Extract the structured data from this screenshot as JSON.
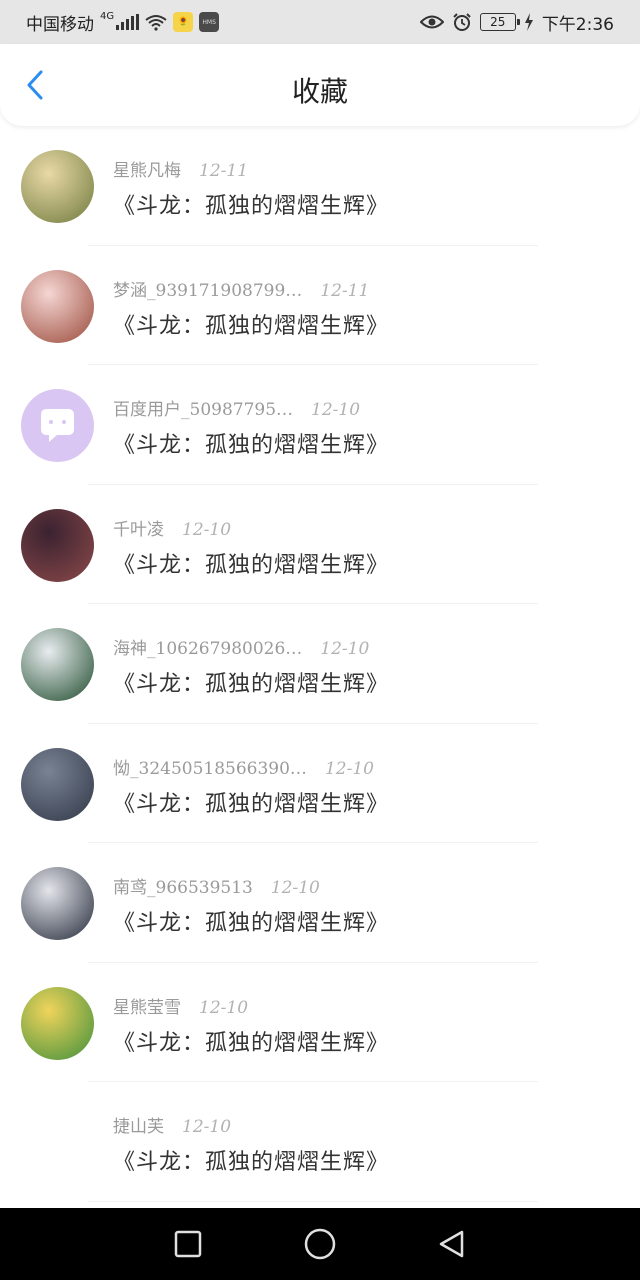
{
  "status_bar": {
    "carrier": "中国移动",
    "network": "4G",
    "app_badge_1": "🌻",
    "app_badge_2": "HMS",
    "battery": "25",
    "time": "下午2:36"
  },
  "header": {
    "title": "收藏",
    "back_icon": "chevron-left-icon"
  },
  "favorites": [
    {
      "user": "星熊凡梅",
      "date": "12-11",
      "title": "《斗龙：孤独的熠熠生辉》",
      "avatar_colors": [
        "#e9d9a8",
        "#6f7a3c"
      ]
    },
    {
      "user": "梦涵_939171908799…",
      "date": "12-11",
      "title": "《斗龙：孤独的熠熠生辉》",
      "avatar_colors": [
        "#f5d6d3",
        "#9a4a3a"
      ]
    },
    {
      "user": "百度用户_50987795…",
      "date": "12-10",
      "title": "《斗龙：孤独的熠熠生辉》",
      "avatar_colors": [
        "#d9c6f3",
        "#d9c6f3"
      ]
    },
    {
      "user": "千叶凌",
      "date": "12-10",
      "title": "《斗龙：孤独的熠熠生辉》",
      "avatar_colors": [
        "#3a2230",
        "#8c4a4a"
      ]
    },
    {
      "user": "海神_106267980026…",
      "date": "12-10",
      "title": "《斗龙：孤独的熠熠生辉》",
      "avatar_colors": [
        "#e8ecef",
        "#1f4b2d"
      ]
    },
    {
      "user": "怮_32450518566390…",
      "date": "12-10",
      "title": "《斗龙：孤独的熠熠生辉》",
      "avatar_colors": [
        "#7a8393",
        "#303848"
      ]
    },
    {
      "user": "南鸢_966539513",
      "date": "12-10",
      "title": "《斗龙：孤独的熠熠生辉》",
      "avatar_colors": [
        "#e3e5ea",
        "#242a3a"
      ]
    },
    {
      "user": "星熊莹雪",
      "date": "12-10",
      "title": "《斗龙：孤独的熠熠生辉》",
      "avatar_colors": [
        "#f0d45c",
        "#3f8f3a"
      ]
    },
    {
      "user": "捷山芙",
      "date": "12-10",
      "title": "《斗龙：孤独的熠熠生辉》",
      "avatar_colors": [
        "#ffffff",
        "#ffffff"
      ]
    }
  ],
  "system_nav": {
    "recent": "square-icon",
    "home": "circle-icon",
    "back": "triangle-back-icon"
  }
}
